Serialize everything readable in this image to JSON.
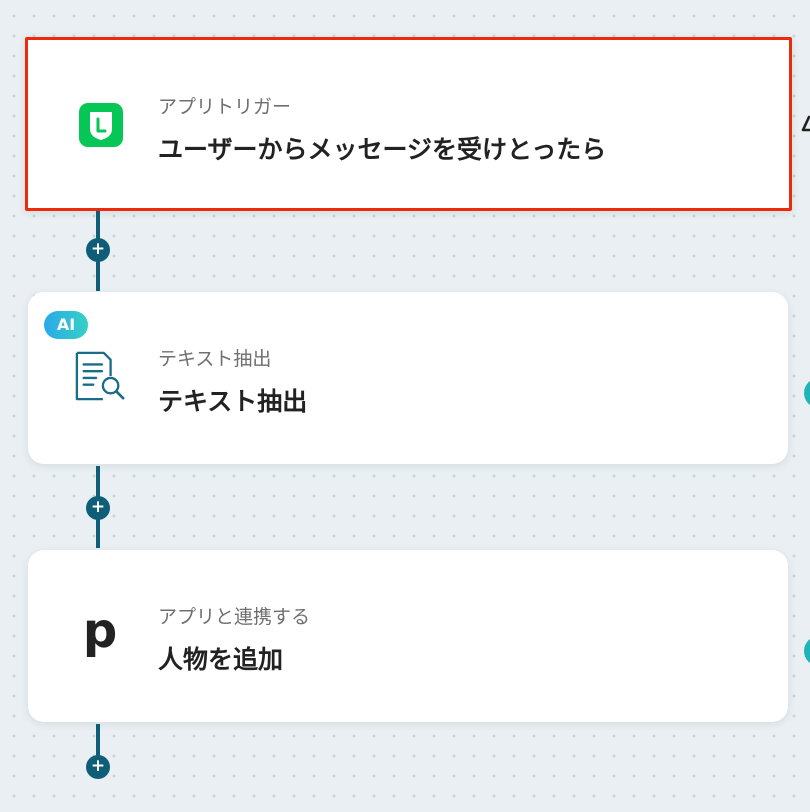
{
  "flow": {
    "add_step_label": "+",
    "steps": [
      {
        "subtitle": "アプリトリガー",
        "title": "ユーザーからメッセージを受けとったら",
        "icon": "line-app-icon",
        "selected": true
      },
      {
        "badge": "AI",
        "subtitle": "テキスト抽出",
        "title": "テキスト抽出",
        "icon": "document-search-icon"
      },
      {
        "subtitle": "アプリと連携する",
        "title": "人物を追加",
        "icon": "pipedrive-p-icon",
        "icon_glyph": "p"
      }
    ]
  },
  "colors": {
    "connector": "#0f5e78",
    "selected_border": "#ee2a0c",
    "line_green": "#06c755",
    "ai_badge_start": "#2aa9ea",
    "ai_badge_end": "#36d1c4",
    "side_dot": "#1fb5b8"
  }
}
